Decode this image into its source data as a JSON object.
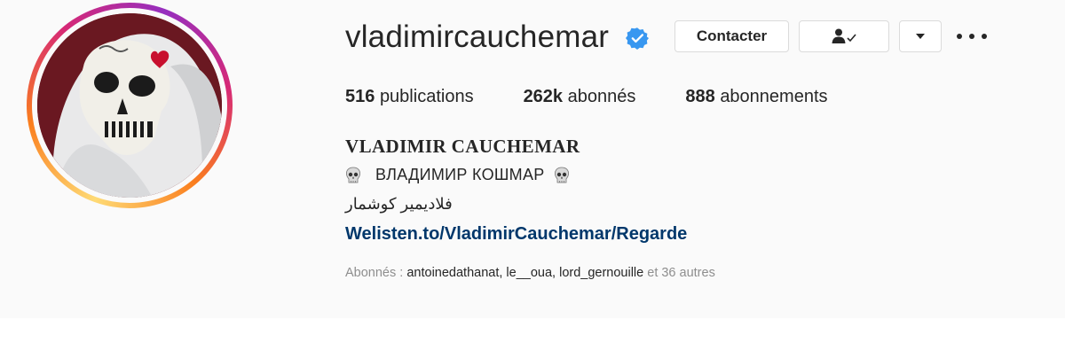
{
  "profile": {
    "username": "vladimircauchemar",
    "verified": true,
    "contact_label": "Contacter",
    "stats": [
      {
        "value": "516",
        "label": "publications"
      },
      {
        "value": "262k",
        "label": "abonnés"
      },
      {
        "value": "888",
        "label": "abonnements"
      }
    ],
    "full_name": "VLADIMIR CAUCHEMAR",
    "bio_line_1": "ВЛАДИМИР КОШМАР",
    "bio_line_2": "فلاديمير كوشمار",
    "link": "Welisten.to/VladimirCauchemar/Regarde",
    "followed_by": {
      "prefix": "Abonnés :",
      "accounts": [
        "antoinedathanat",
        "le__oua",
        "lord_gernouille"
      ],
      "suffix": "et 36 autres"
    }
  },
  "icons": {
    "verified": "verified-badge-icon",
    "follow": "person-check-icon",
    "dropdown": "caret-down-icon",
    "more": "more-horizontal-icon",
    "skull": "skull-icon"
  },
  "colors": {
    "link": "#00376b",
    "verified": "#3897f0",
    "secondary_text": "#8e8e8e",
    "background": "#fafafa"
  }
}
